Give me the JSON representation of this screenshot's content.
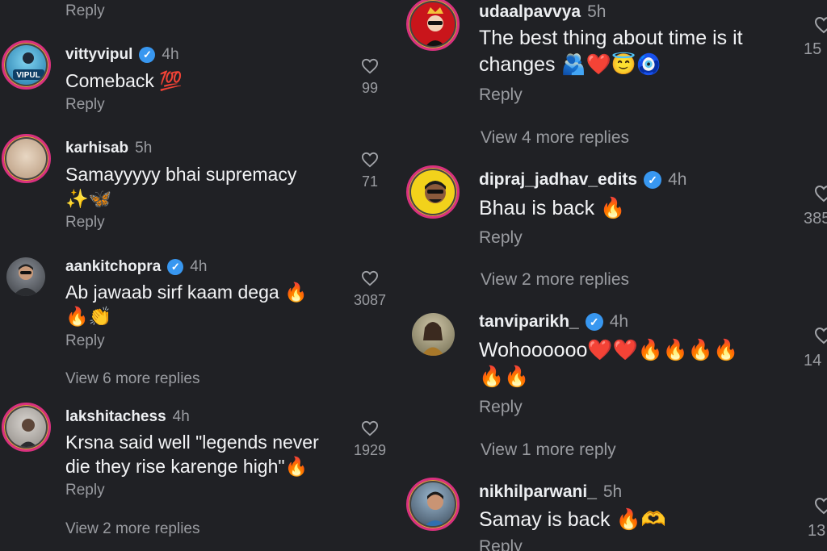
{
  "left": {
    "top_reply": "Reply",
    "comments": [
      {
        "username": "vittyvipul",
        "verified": true,
        "time": "4h",
        "text": "Comeback 💯",
        "reply": "Reply",
        "likes": "99",
        "avatar_text": "VIPUL"
      },
      {
        "username": "karhisab",
        "verified": false,
        "time": "5h",
        "text": "Samayyyyy bhai supremacy ✨🦋",
        "reply": "Reply",
        "likes": "71"
      },
      {
        "username": "aankitchopra",
        "verified": true,
        "time": "4h",
        "text": "Ab jawaab sirf kaam dega 🔥🔥👏",
        "reply": "Reply",
        "likes": "3087",
        "more_replies": "View 6 more replies"
      },
      {
        "username": "lakshitachess",
        "verified": false,
        "time": "4h",
        "text": "Krsna said well \"legends never die they rise karenge high\"🔥",
        "reply": "Reply",
        "likes": "1929",
        "more_replies": "View 2 more replies"
      }
    ]
  },
  "right": {
    "comments": [
      {
        "username": "udaalpavvya",
        "verified": false,
        "time": "5h",
        "text": "The best thing about time is it changes 🫂❤️😇🧿",
        "reply": "Reply",
        "likes": "15",
        "more_replies": "View 4 more replies"
      },
      {
        "username": "dipraj_jadhav_edits",
        "verified": true,
        "time": "4h",
        "text": "Bhau is back 🔥",
        "reply": "Reply",
        "likes": "385",
        "more_replies": "View 2 more replies"
      },
      {
        "username": "tanviparikh_",
        "verified": true,
        "time": "4h",
        "text": "Wohoooooo❤️❤️🔥🔥🔥🔥🔥🔥",
        "reply": "Reply",
        "likes": "14",
        "more_replies": "View 1 more reply"
      },
      {
        "username": "nikhilparwani_",
        "verified": false,
        "time": "5h",
        "text": "Samay is back 🔥🫶",
        "reply": "Reply",
        "likes": "13"
      }
    ]
  },
  "colors": {
    "background": "#202125",
    "verified": "#3897f0",
    "muted": "#9a9ca1"
  }
}
